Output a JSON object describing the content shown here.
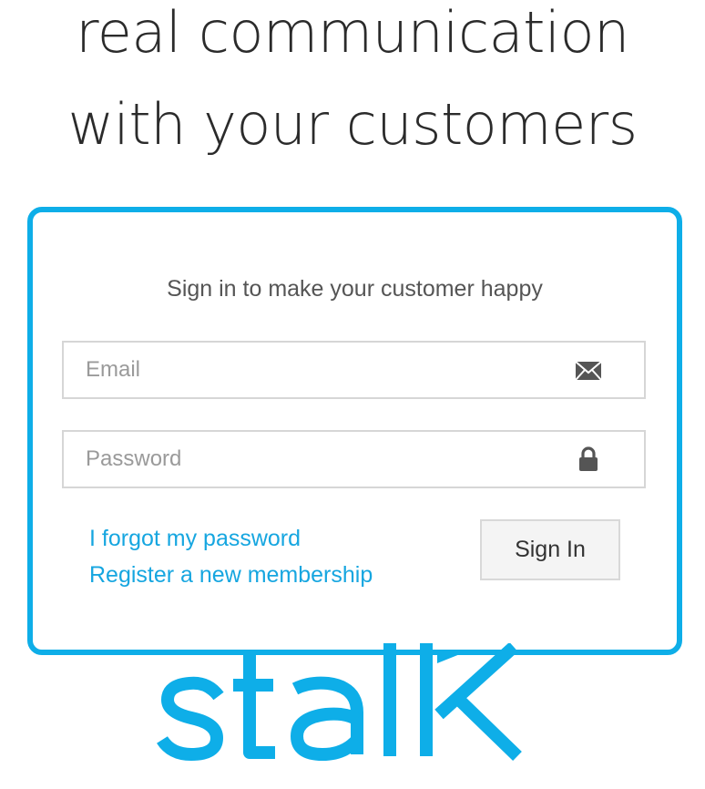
{
  "hero": {
    "line1": "real communication",
    "line2": "with your customers"
  },
  "login": {
    "subtitle": "Sign in to make your customer happy",
    "email_placeholder": "Email",
    "password_placeholder": "Password",
    "forgot_link": "I forgot my password",
    "register_link": "Register a new membership",
    "signin_label": "Sign In"
  },
  "brand": {
    "logo_text": "stalk",
    "color": "#0eaee8"
  },
  "icons": {
    "email": "envelope-icon",
    "password": "lock-icon"
  }
}
